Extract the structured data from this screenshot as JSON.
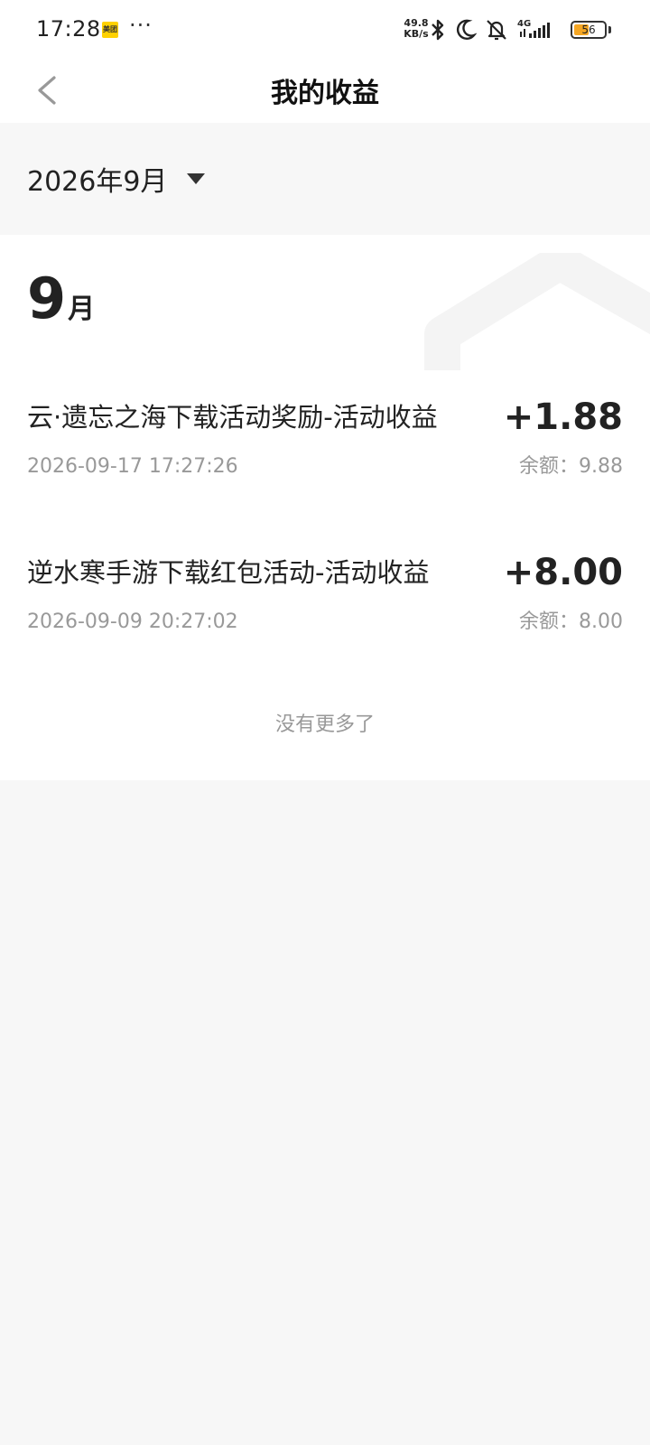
{
  "status_bar": {
    "time": "17:28",
    "app_badge": "美团",
    "more": "···",
    "net_speed_value": "49.8",
    "net_speed_unit": "KB/s",
    "network_type": "4G",
    "battery": "56",
    "battery_level": 0.56
  },
  "header": {
    "title": "我的收益"
  },
  "month_selector": {
    "label": "2026年9月"
  },
  "month_section": {
    "number": "9",
    "unit": "月"
  },
  "records": [
    {
      "title": "云·遗忘之海下载活动奖励-活动收益",
      "amount": "+1.88",
      "time": "2026-09-17 17:27:26",
      "balance": "余额：9.88"
    },
    {
      "title": "逆水寒手游下载红包活动-活动收益",
      "amount": "+8.00",
      "time": "2026-09-09 20:27:02",
      "balance": "余额：8.00"
    }
  ],
  "footer": {
    "no_more": "没有更多了"
  },
  "colors": {
    "page_background": "#f7f7f7",
    "card_background": "#ffffff",
    "primary_text": "#222222",
    "secondary_text": "#999999",
    "battery_fill": "#f5a623",
    "badge_yellow": "#ffd100"
  }
}
